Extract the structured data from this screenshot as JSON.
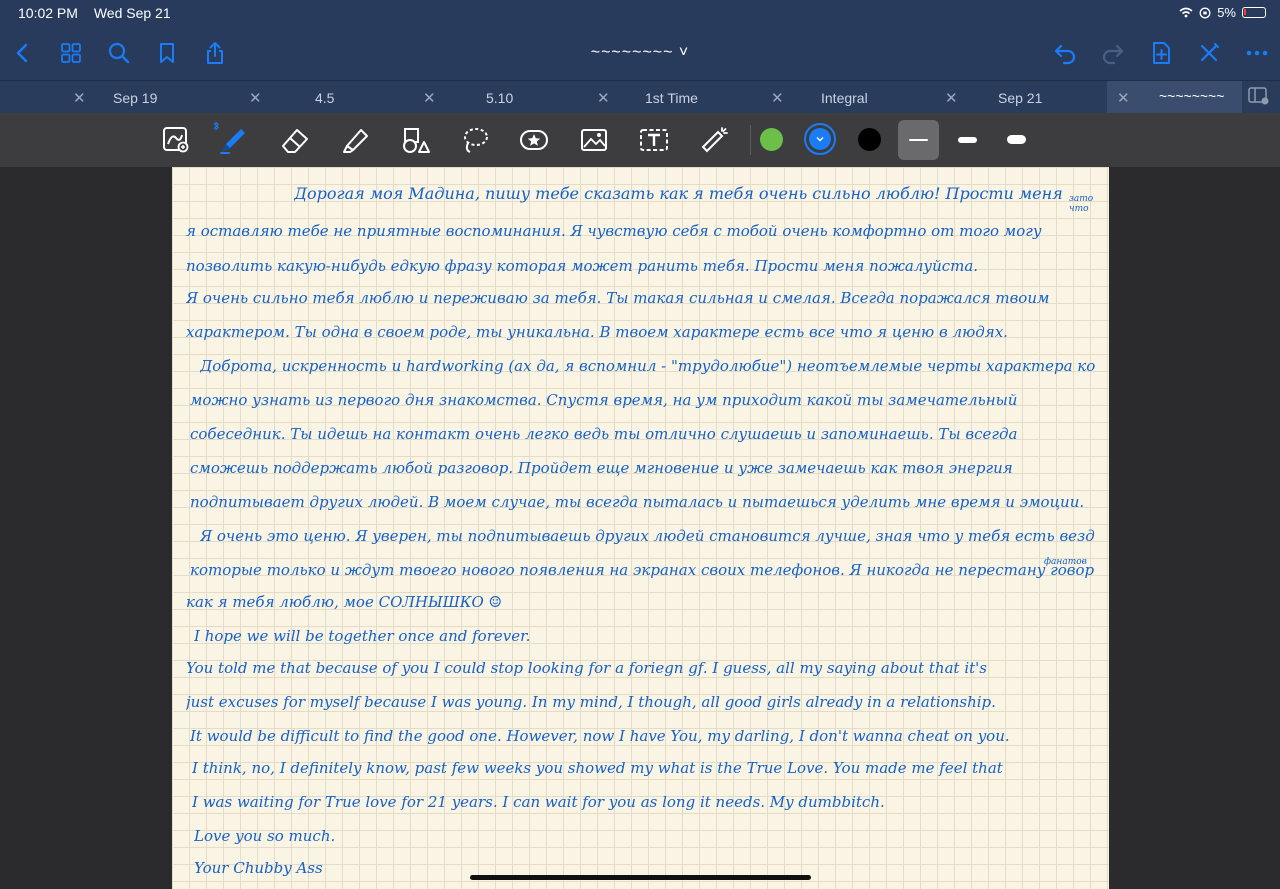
{
  "status": {
    "time": "10:02 PM",
    "date": "Wed Sep 21",
    "battery": "5%"
  },
  "doc": {
    "title": "~~~~~~~~ ˅"
  },
  "tabs": [
    {
      "label": "Sep 19"
    },
    {
      "label": "4.5"
    },
    {
      "label": "5.10"
    },
    {
      "label": "1st Time"
    },
    {
      "label": "Integral"
    },
    {
      "label": "Sep 21"
    },
    {
      "label": "~~~~~~~~"
    }
  ],
  "tab_close": "✕",
  "toolbar": {
    "colors": [
      "#6cc04a",
      "#1a7cf7",
      "#000000"
    ],
    "selected_color": "#1a7cf7"
  },
  "note": {
    "lines": [
      "Дорогая моя Мадина, пишу тебе сказать как я тебя очень сильно люблю! Прости меня",
      "я оставляю тебе не приятные воспоминания. Я чувствую себя с тобой очень комфортно от того могу",
      "позволить какую-нибудь едкую фразу которая может ранить тебя. Прости меня пожалуйста.",
      "Я очень сильно тебя люблю и переживаю за тебя. Ты такая сильная и смелая. Всегда поражался твоим",
      "характером. Ты одна в своем роде, ты уникальна. В твоем характере есть все что я ценю в людях.",
      "Доброта, искренность и hardworking (ах да, я вспомнил - \"трудолюбие\") неотъемлемые черты характера которые",
      "можно узнать из первого дня знакомства. Спустя время, на ум приходит какой ты замечательный",
      "собеседник. Ты идешь на контакт очень легко ведь ты отлично слушаешь и запоминаешь. Ты всегда",
      "сможешь поддержать любой разговор. Пройдет еще мгновение и уже замечаешь как твоя энергия",
      "подпитывает других людей. В моем случае, ты всегда пыталась и пытаешься уделить мне время и эмоции.",
      "Я очень это ценю. Я уверен, ты подпитываешь других людей становится лучше, зная что у тебя есть везде",
      "которые только и ждут твоего нового появления на экранах своих телефонов. Я никогда не перестану говорить",
      "как я тебя люблю, мое СОЛНЫШКО ☺",
      "I hope we will be together once and forever.",
      "You told me that because of you I could stop looking for a foriegn gf. I guess, all my saying about that it's",
      "just excuses for myself because I was young. In my mind, I though, all good girls already in a relationship.",
      "It would be difficult to find the good one. However, now I have You, my darling, I don't wanna cheat on you.",
      "I think, no, I definitely know, past few weeks you showed my what is the True Love. You made me feel that",
      "I was waiting for True love for 21 years. I can wait for you as long it needs. My dumbbitch.",
      "Love you so much.",
      "Your Chubby Ass"
    ],
    "margin_notes": [
      "зато что",
      "фанатов"
    ]
  }
}
